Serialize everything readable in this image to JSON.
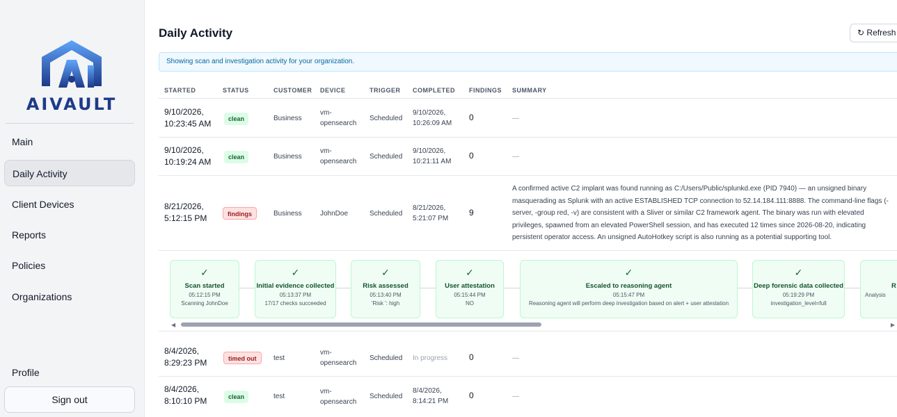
{
  "sidebar": {
    "logo_text": "AIVAULT",
    "nav": [
      {
        "label": "Main",
        "active": false
      },
      {
        "label": "Daily Activity",
        "active": true
      },
      {
        "label": "Client Devices",
        "active": false
      },
      {
        "label": "Reports",
        "active": false
      },
      {
        "label": "Policies",
        "active": false
      },
      {
        "label": "Organizations",
        "active": false
      }
    ],
    "profile_label": "Profile",
    "signout_label": "Sign out"
  },
  "header": {
    "title": "Daily Activity",
    "refresh_icon": "↻",
    "refresh_label": "Refresh"
  },
  "info_banner": "Showing scan and investigation activity for your organization.",
  "table": {
    "columns": [
      "STARTED",
      "STATUS",
      "CUSTOMER",
      "DEVICE",
      "TRIGGER",
      "COMPLETED",
      "FINDINGS",
      "SUMMARY"
    ],
    "rows": [
      {
        "started": [
          "9/10/2026,",
          "10:23:45 AM"
        ],
        "status": "clean",
        "customer": "Business",
        "device": [
          "vm-",
          "opensearch"
        ],
        "trigger": "Scheduled",
        "completed": [
          "9/10/2026,",
          "10:26:09 AM"
        ],
        "findings": "0",
        "summary": "—"
      },
      {
        "started": [
          "9/10/2026,",
          "10:19:24 AM"
        ],
        "status": "clean",
        "customer": "Business",
        "device": [
          "vm-",
          "opensearch"
        ],
        "trigger": "Scheduled",
        "completed": [
          "9/10/2026,",
          "10:21:11 AM"
        ],
        "findings": "0",
        "summary": "—"
      },
      {
        "started": [
          "8/21/2026,",
          "5:12:15 PM"
        ],
        "status": "findings",
        "customer": "Business",
        "device": [
          "JohnDoe"
        ],
        "trigger": "Scheduled",
        "completed": [
          "8/21/2026,",
          "5:21:07 PM"
        ],
        "findings": "9",
        "summary": "A confirmed active C2 implant was found running as C:/Users/Public/splunkd.exe (PID 7940) — an unsigned binary masquerading as Splunk with an active ESTABLISHED TCP connection to 52.14.184.111:8888. The command-line flags (-server, -group red, -v) are consistent with a Sliver or similar C2 framework agent. The binary was run with elevated privileges, spawned from an elevated PowerShell session, and has executed 12 times since 2026-08-20, indicating persistent operator access. An unsigned AutoHotkey script is also running as a potential supporting tool."
      },
      {
        "started": [
          "8/4/2026,",
          "8:29:23 PM"
        ],
        "status": "timed out",
        "customer": "test",
        "device": [
          "vm-",
          "opensearch"
        ],
        "trigger": "Scheduled",
        "completed": [
          "In progress"
        ],
        "findings": "0",
        "summary": "—"
      },
      {
        "started": [
          "8/4/2026,",
          "8:10:10 PM"
        ],
        "status": "clean",
        "customer": "test",
        "device": [
          "vm-",
          "opensearch"
        ],
        "trigger": "Scheduled",
        "completed": [
          "8/4/2026,",
          "8:14:21 PM"
        ],
        "findings": "0",
        "summary": "—"
      }
    ]
  },
  "timeline": {
    "check_icon": "✓",
    "steps": [
      {
        "label": "Scan started",
        "time": "05:12:15 PM",
        "detail": "Scanning JohnDoe"
      },
      {
        "label": "Initial evidence collected",
        "time": "05:13:37 PM",
        "detail": "17/17 checks succeeded"
      },
      {
        "label": "Risk assessed",
        "time": "05:13:40 PM",
        "detail": "'Risk ': high"
      },
      {
        "label": "User attestation",
        "time": "05:15:44 PM",
        "detail": "NO"
      },
      {
        "label": "Escaled to reasoning agent",
        "time": "05:15:47 PM",
        "detail": "Reasoning agent will perform deep investigation based on alert + user attestation"
      },
      {
        "label": "Deep forensic data collected",
        "time": "05:19:29 PM",
        "detail": "investigation_level=full"
      },
      {
        "label": "R",
        "time": "",
        "detail": "Analysis"
      }
    ],
    "scroll_position": 0.0
  }
}
